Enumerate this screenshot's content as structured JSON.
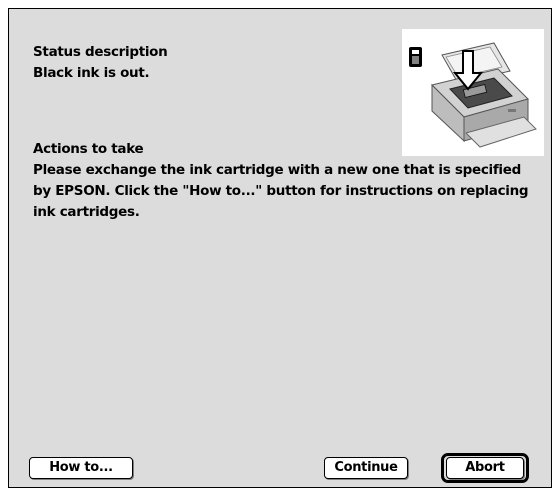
{
  "status": {
    "heading": "Status description",
    "message": "Black ink is out."
  },
  "actions": {
    "heading": "Actions to take",
    "lines": [
      "Please exchange the ink cartridge with a new one that is specified",
      "by EPSON. Click the \"How to...\" button for instructions on replacing",
      "ink cartridges."
    ]
  },
  "illustration": {
    "icon": "printer-ink-cartridge-icon",
    "background_color": "#ffffff"
  },
  "buttons": {
    "howto_label": "How to...",
    "continue_label": "Continue",
    "abort_label": "Abort"
  },
  "colors": {
    "dialog_background": "#dcdcdc",
    "border": "#000000",
    "text": "#000000"
  }
}
